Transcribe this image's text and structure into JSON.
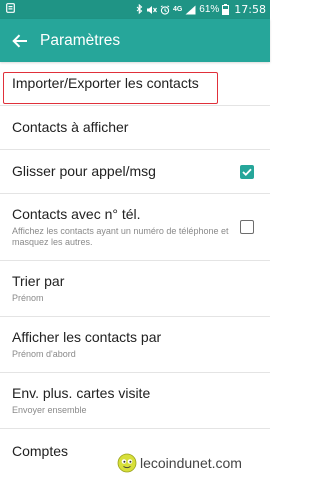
{
  "status_bar": {
    "network": "4G",
    "battery": "61%",
    "time": "17:58"
  },
  "app_bar": {
    "title": "Paramètres"
  },
  "settings": [
    {
      "title": "Importer/Exporter les contacts",
      "subtitle": ""
    },
    {
      "title": "Contacts à afficher",
      "subtitle": ""
    },
    {
      "title": "Glisser pour appel/msg",
      "subtitle": "",
      "checked": true
    },
    {
      "title": "Contacts avec n° tél.",
      "subtitle": "Affichez les contacts ayant un numéro de téléphone et masquez les autres.",
      "checked": false
    },
    {
      "title": "Trier par",
      "subtitle": "Prénom"
    },
    {
      "title": "Afficher les contacts par",
      "subtitle": "Prénom d'abord"
    },
    {
      "title": "Env. plus. cartes visite",
      "subtitle": "Envoyer ensemble"
    },
    {
      "title": "Comptes",
      "subtitle": ""
    }
  ],
  "watermark": {
    "text": "lecoindunet.com"
  },
  "colors": {
    "primary": "#26a69a",
    "status_bar": "#1f9485",
    "highlight_border": "#e0303a"
  }
}
